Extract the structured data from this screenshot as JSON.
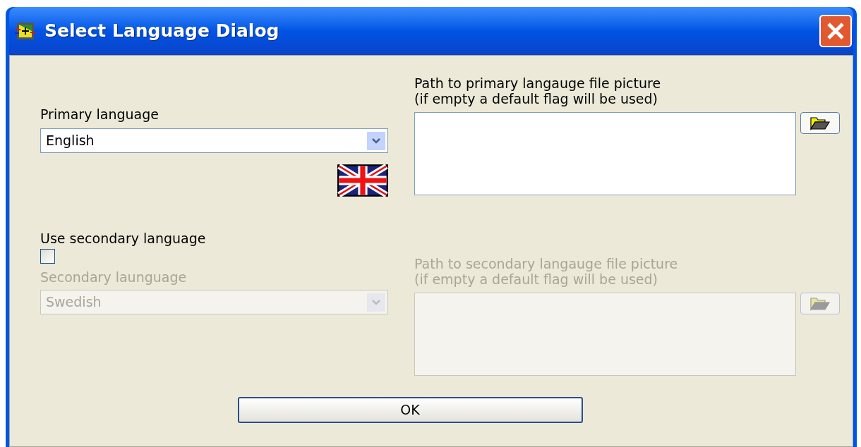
{
  "window": {
    "title": "Select Language Dialog"
  },
  "primary": {
    "label": "Primary language",
    "value": "English",
    "disabled": false
  },
  "primary_path": {
    "label": "Path to primary langauge file picture",
    "hint": "(if empty a default flag will be used)",
    "disabled": false
  },
  "secondary_toggle": {
    "label": "Use secondary language",
    "checked": false
  },
  "secondary": {
    "label": "Secondary launguage",
    "value": "Swedish",
    "disabled": true
  },
  "secondary_path": {
    "label": "Path to secondary langauge file picture",
    "hint": "(if empty a default flag will be used)",
    "disabled": true
  },
  "buttons": [
    {
      "label": "OK"
    }
  ]
}
